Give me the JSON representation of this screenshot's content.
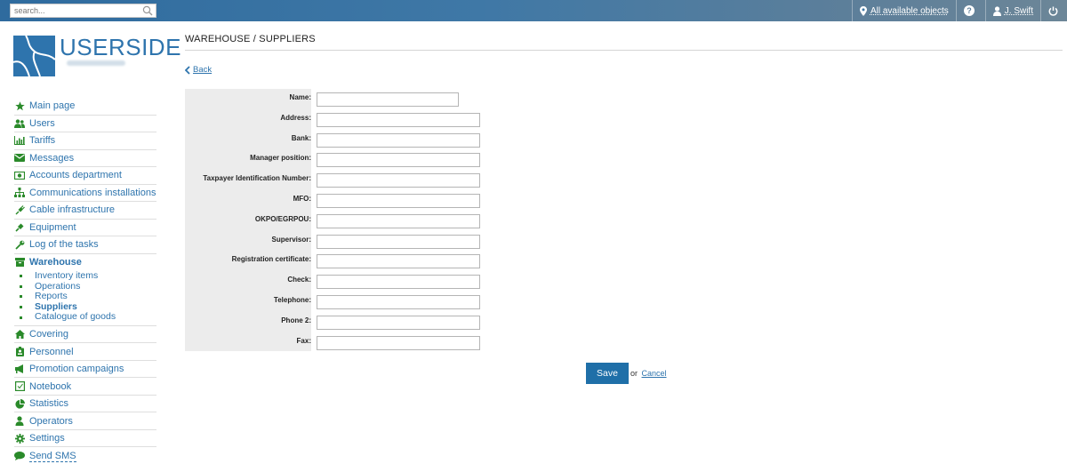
{
  "search": {
    "placeholder": "search..."
  },
  "topbar": {
    "objects_label": "All available objects",
    "user_label": "J. Swift"
  },
  "logo": {
    "text": "USERSIDE"
  },
  "sidebar": {
    "items": [
      {
        "label": "Main page",
        "icon": "star-icon"
      },
      {
        "label": "Users",
        "icon": "users-icon"
      },
      {
        "label": "Tariffs",
        "icon": "chart-icon"
      },
      {
        "label": "Messages",
        "icon": "envelope-icon"
      },
      {
        "label": "Accounts department",
        "icon": "money-icon"
      },
      {
        "label": "Communications installations",
        "icon": "sitemap-icon"
      },
      {
        "label": "Cable infrastructure",
        "icon": "plug-icon"
      },
      {
        "label": "Equipment",
        "icon": "plug-icon"
      },
      {
        "label": "Log of the tasks",
        "icon": "wrench-icon"
      },
      {
        "label": "Warehouse",
        "icon": "box-icon"
      },
      {
        "label": "Covering",
        "icon": "home-icon"
      },
      {
        "label": "Personnel",
        "icon": "badge-icon"
      },
      {
        "label": "Promotion campaigns",
        "icon": "megaphone-icon"
      },
      {
        "label": "Notebook",
        "icon": "notebook-icon"
      },
      {
        "label": "Statistics",
        "icon": "pie-icon"
      },
      {
        "label": "Operators",
        "icon": "operator-icon"
      },
      {
        "label": "Settings",
        "icon": "gear-icon"
      },
      {
        "label": "Send SMS",
        "icon": "chat-icon"
      }
    ],
    "warehouse_sub": [
      "Inventory items",
      "Operations",
      "Reports",
      "Suppliers",
      "Catalogue of goods"
    ]
  },
  "main": {
    "title": "WAREHOUSE / SUPPLIERS",
    "back_label": "Back",
    "fields": [
      {
        "label": "Name:",
        "value": ""
      },
      {
        "label": "Address:",
        "value": ""
      },
      {
        "label": "Bank:",
        "value": ""
      },
      {
        "label": "Manager position:",
        "value": ""
      },
      {
        "label": "Taxpayer Identification Number:",
        "value": ""
      },
      {
        "label": "MFO:",
        "value": ""
      },
      {
        "label": "OKPO/EGRPOU:",
        "value": ""
      },
      {
        "label": "Supervisor:",
        "value": ""
      },
      {
        "label": "Registration certificate:",
        "value": ""
      },
      {
        "label": "Check:",
        "value": ""
      },
      {
        "label": "Telephone:",
        "value": ""
      },
      {
        "label": "Phone 2:",
        "value": ""
      },
      {
        "label": "Fax:",
        "value": ""
      }
    ],
    "save_label": "Save",
    "or_label": "or",
    "cancel_label": "Cancel"
  },
  "colors": {
    "accent": "#2e74ad",
    "icon_green": "#2a8a2a",
    "button": "#1f6fa8"
  }
}
